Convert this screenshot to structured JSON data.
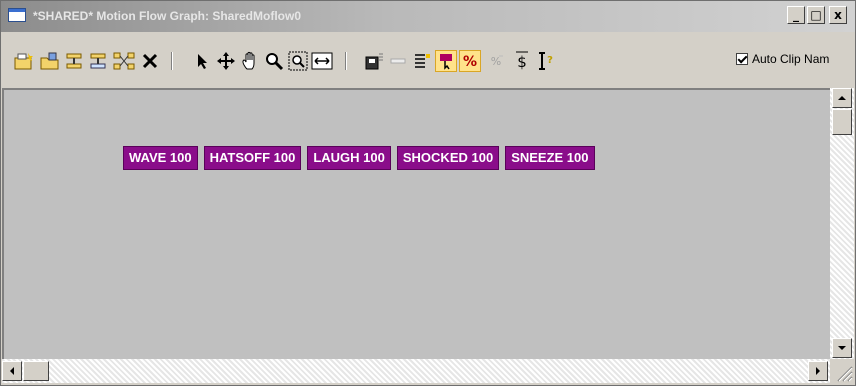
{
  "window": {
    "title": "*SHARED* Motion Flow Graph: SharedMoflow0",
    "caption_buttons": {
      "minimize": "_",
      "maximize": "□",
      "close": "x"
    }
  },
  "toolbar": {
    "icons": [
      "new-clip-icon",
      "open-icon",
      "insert-icon",
      "append-icon",
      "network-icon",
      "delete-icon",
      "select-arrow-icon",
      "move-icon",
      "pan-hand-icon",
      "zoom-icon",
      "zoom-region-icon",
      "zoom-extents-icon",
      "save-icon",
      "blank-bar-icon",
      "list-icon",
      "highlight-icon",
      "percent-icon",
      "randomize-icon",
      "dollar-icon",
      "cursor-help-icon"
    ],
    "auto_clip_label": "Auto Clip Nam",
    "auto_clip_checked": true,
    "accent_color": "#ffe28a"
  },
  "clips": [
    {
      "label": "WAVE 100"
    },
    {
      "label": "HATSOFF 100"
    },
    {
      "label": "LAUGH 100"
    },
    {
      "label": "SHOCKED 100"
    },
    {
      "label": "SNEEZE 100"
    }
  ],
  "colors": {
    "clip_bg": "#8a0d8a",
    "canvas_bg": "#c0c0c0",
    "chrome": "#d4d0c8"
  }
}
